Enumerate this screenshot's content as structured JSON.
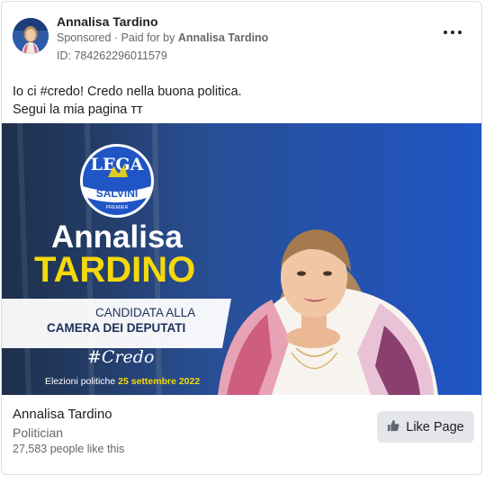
{
  "post": {
    "author_name": "Annalisa Tardino",
    "sponsored_label": "Sponsored",
    "paid_for_prefix": "Paid for by",
    "paid_for_name": "Annalisa Tardino",
    "ad_id": "ID: 784262296011579",
    "text_line1": "Io ci #credo! Credo nella buona politica.",
    "text_line2": "Segui la mia pagina ᴛᴛ"
  },
  "banner": {
    "logo_top": "LEGA",
    "logo_band": "SALVINI",
    "logo_bottom": "PREMIER",
    "first_name": "Annalisa",
    "last_name": "TARDINO",
    "candidate_line1": "CANDIDATA ALLA",
    "candidate_line2": "CAMERA DEI DEPUTATI",
    "hashtag": "#Credo",
    "election_prefix": "Elezioni politiche ",
    "election_date": "25 settembre 2022"
  },
  "footer": {
    "page_name": "Annalisa Tardino",
    "category": "Politician",
    "likes": "27,583 people like this",
    "like_button": "Like Page"
  },
  "colors": {
    "brand_yellow": "#f5d90a",
    "brand_blue": "#1f55c5",
    "button_bg": "#e4e6eb"
  },
  "icons": [
    "ellipsis-icon",
    "thumbs-up-icon",
    "lega-logo",
    "avatar"
  ]
}
